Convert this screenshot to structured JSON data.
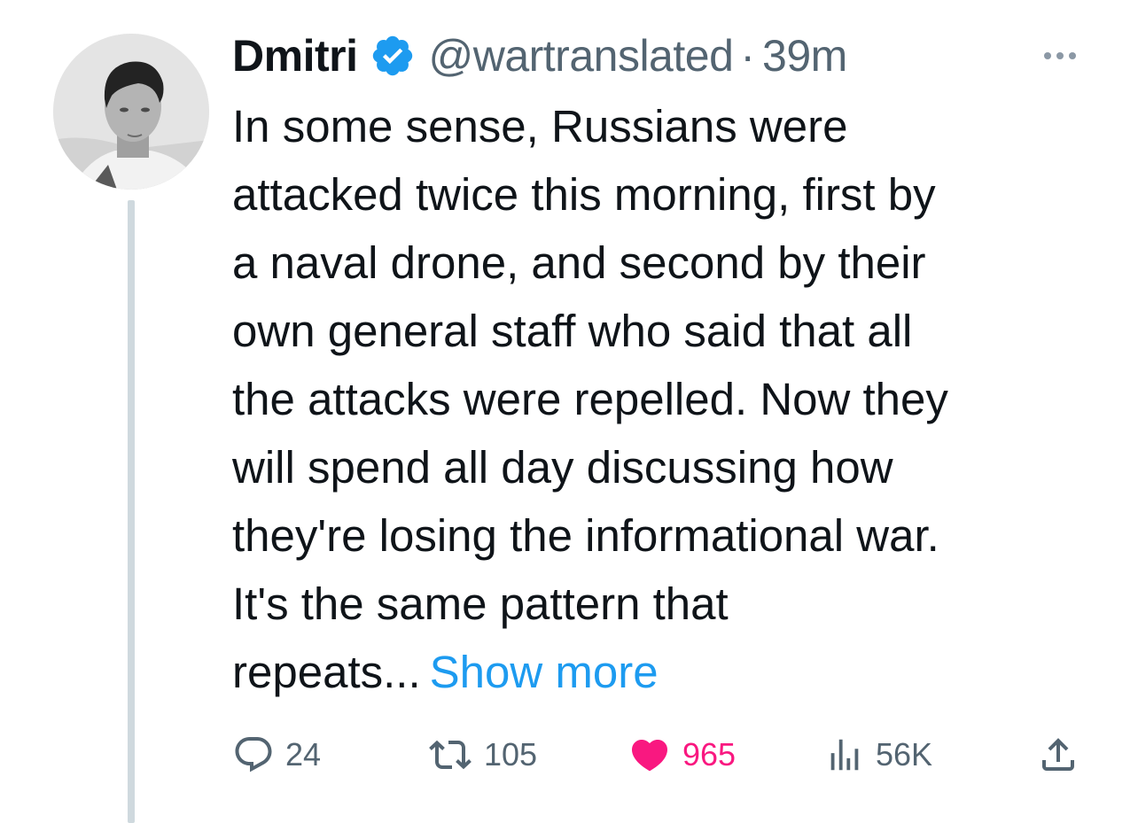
{
  "author": {
    "display_name": "Dmitri",
    "handle": "@wartranslated",
    "separator": "·",
    "time": "39m",
    "verified": true
  },
  "tweet": {
    "lines": [
      "In some sense, Russians were",
      "attacked twice this morning, first by",
      "a naval drone, and second by their",
      "own general staff who said that all",
      "the attacks were repelled. Now they",
      "will spend all day discussing how",
      "they're losing the informational war.",
      "It's the same pattern that",
      "repeats..."
    ],
    "show_more_label": "Show more"
  },
  "actions": {
    "replies": "24",
    "retweets": "105",
    "likes": "965",
    "views": "56K"
  },
  "colors": {
    "text": "#0f1419",
    "secondary": "#536471",
    "link": "#1d9bf0",
    "like": "#f91880",
    "verified": "#1d9bf0",
    "thread_line": "#cfd9de"
  },
  "icons": {
    "verified": "verified-badge-icon",
    "more": "more-dots-icon",
    "reply": "reply-icon",
    "retweet": "retweet-icon",
    "like": "heart-icon",
    "views": "views-bar-icon",
    "share": "share-icon"
  }
}
